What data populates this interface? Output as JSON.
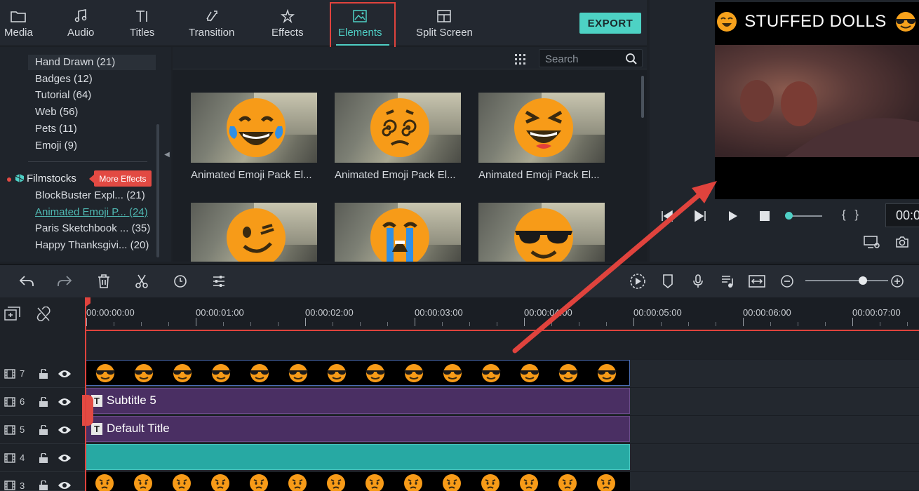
{
  "tabs": [
    {
      "label": "Media",
      "icon": "folder-icon"
    },
    {
      "label": "Audio",
      "icon": "music-note-icon"
    },
    {
      "label": "Titles",
      "icon": "text-icon"
    },
    {
      "label": "Transition",
      "icon": "transition-icon"
    },
    {
      "label": "Effects",
      "icon": "effects-icon"
    },
    {
      "label": "Elements",
      "icon": "image-icon",
      "active": true
    },
    {
      "label": "Split Screen",
      "icon": "split-screen-icon"
    }
  ],
  "export_label": "EXPORT",
  "sidebar": {
    "categories": [
      {
        "label": "Hand Drawn (21)",
        "selected": true
      },
      {
        "label": "Badges (12)"
      },
      {
        "label": "Tutorial (64)"
      },
      {
        "label": "Web (56)"
      },
      {
        "label": "Pets (11)"
      },
      {
        "label": "Emoji (9)"
      }
    ],
    "filmstocks_label": "Filmstocks",
    "more_effects_label": "More Effects",
    "filmstock_items": [
      {
        "label": "BlockBuster Expl...",
        "count": "(21)"
      },
      {
        "label": "Animated Emoji P...",
        "count": "(24)",
        "active": true
      },
      {
        "label": "Paris Sketchbook ...",
        "count": "(35)"
      },
      {
        "label": "Happy Thanksgivi...",
        "count": "(20)"
      }
    ]
  },
  "search": {
    "placeholder": "Search"
  },
  "library": {
    "items": [
      {
        "caption": "Animated Emoji Pack El...",
        "emoji": "laugh-tears"
      },
      {
        "caption": "Animated Emoji Pack El...",
        "emoji": "dizzy"
      },
      {
        "caption": "Animated Emoji Pack El...",
        "emoji": "grin-squint"
      },
      {
        "caption": "",
        "emoji": "wink"
      },
      {
        "caption": "",
        "emoji": "crying"
      },
      {
        "caption": "",
        "emoji": "sunglasses"
      }
    ]
  },
  "preview": {
    "title": "STUFFED DOLLS",
    "timecode": "00:0"
  },
  "timeline": {
    "ruler": [
      "00:00:00:00",
      "00:00:01:00",
      "00:00:02:00",
      "00:00:03:00",
      "00:00:04:00",
      "00:00:05:00",
      "00:00:06:00",
      "00:00:07:00"
    ],
    "tracks": [
      {
        "num": "7"
      },
      {
        "num": "6"
      },
      {
        "num": "5"
      },
      {
        "num": "4"
      },
      {
        "num": "3"
      }
    ],
    "clips": {
      "subtitle": "Subtitle 5",
      "default_title": "Default Title"
    }
  },
  "colors": {
    "accent": "#4fd0c6",
    "highlight": "#e0433d",
    "title_clip": "#4a2f63",
    "teal_clip": "#27a9a3"
  }
}
